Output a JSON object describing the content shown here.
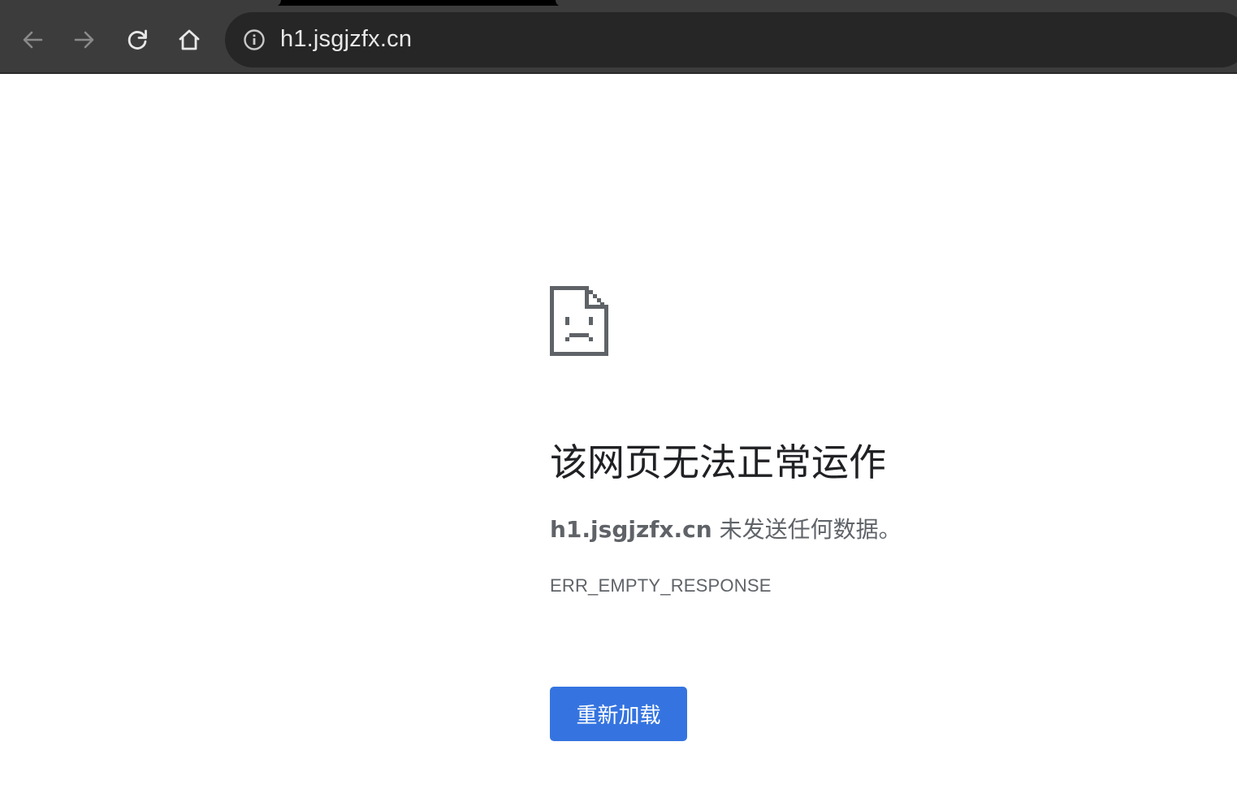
{
  "browser": {
    "url": "h1.jsgjzfx.cn",
    "icons": {
      "back": "arrow-left-icon",
      "forward": "arrow-right-icon",
      "reload": "reload-icon",
      "home": "home-icon",
      "site_info": "info-icon"
    }
  },
  "error_page": {
    "icon": "sad-document-icon",
    "title": "该网页无法正常运作",
    "description_host": "h1.jsgjzfx.cn",
    "description_text": " 未发送任何数据。",
    "error_code": "ERR_EMPTY_RESPONSE",
    "reload_label": "重新加载"
  },
  "colors": {
    "toolbar": "#3c3c3c",
    "omnibox": "#262626",
    "button": "#3574e0",
    "title_text": "#202124",
    "secondary_text": "#5f6368"
  }
}
